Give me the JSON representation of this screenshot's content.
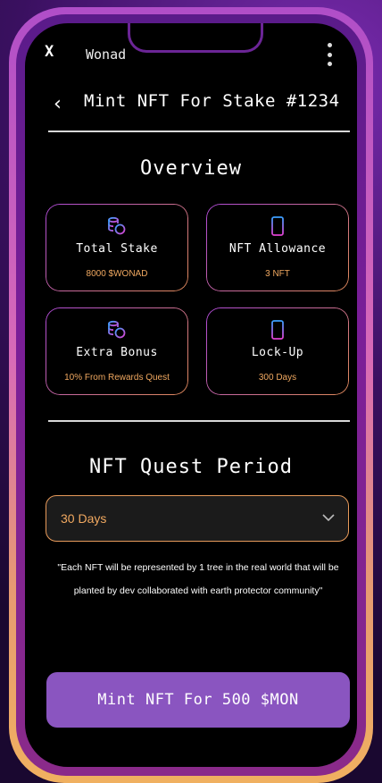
{
  "status": {
    "close": "X",
    "app_name": "Wonad"
  },
  "header": {
    "back": "‹",
    "title": "Mint NFT For Stake #1234"
  },
  "overview": {
    "heading": "Overview",
    "cards": [
      {
        "icon": "coins-icon",
        "label": "Total Stake",
        "value": "8000 $WONAD"
      },
      {
        "icon": "phone-icon",
        "label": "NFT Allowance",
        "value": "3 NFT"
      },
      {
        "icon": "coins-icon",
        "label": "Extra Bonus",
        "value": "10% From Rewards Quest"
      },
      {
        "icon": "phone-icon",
        "label": "Lock-Up",
        "value": "300 Days"
      }
    ]
  },
  "quest": {
    "heading": "NFT Quest Period",
    "selected": "30 Days"
  },
  "note": "\"Each NFT will be represented by 1 tree in the real world that will be planted by dev collaborated with earth protector community\"",
  "cta": {
    "label": "Mint NFT For 500 $MON"
  },
  "colors": {
    "accent": "#f0a860",
    "button": "#8a55c0",
    "gradient_start": "#b04ad8",
    "gradient_end": "#e08a5a"
  }
}
